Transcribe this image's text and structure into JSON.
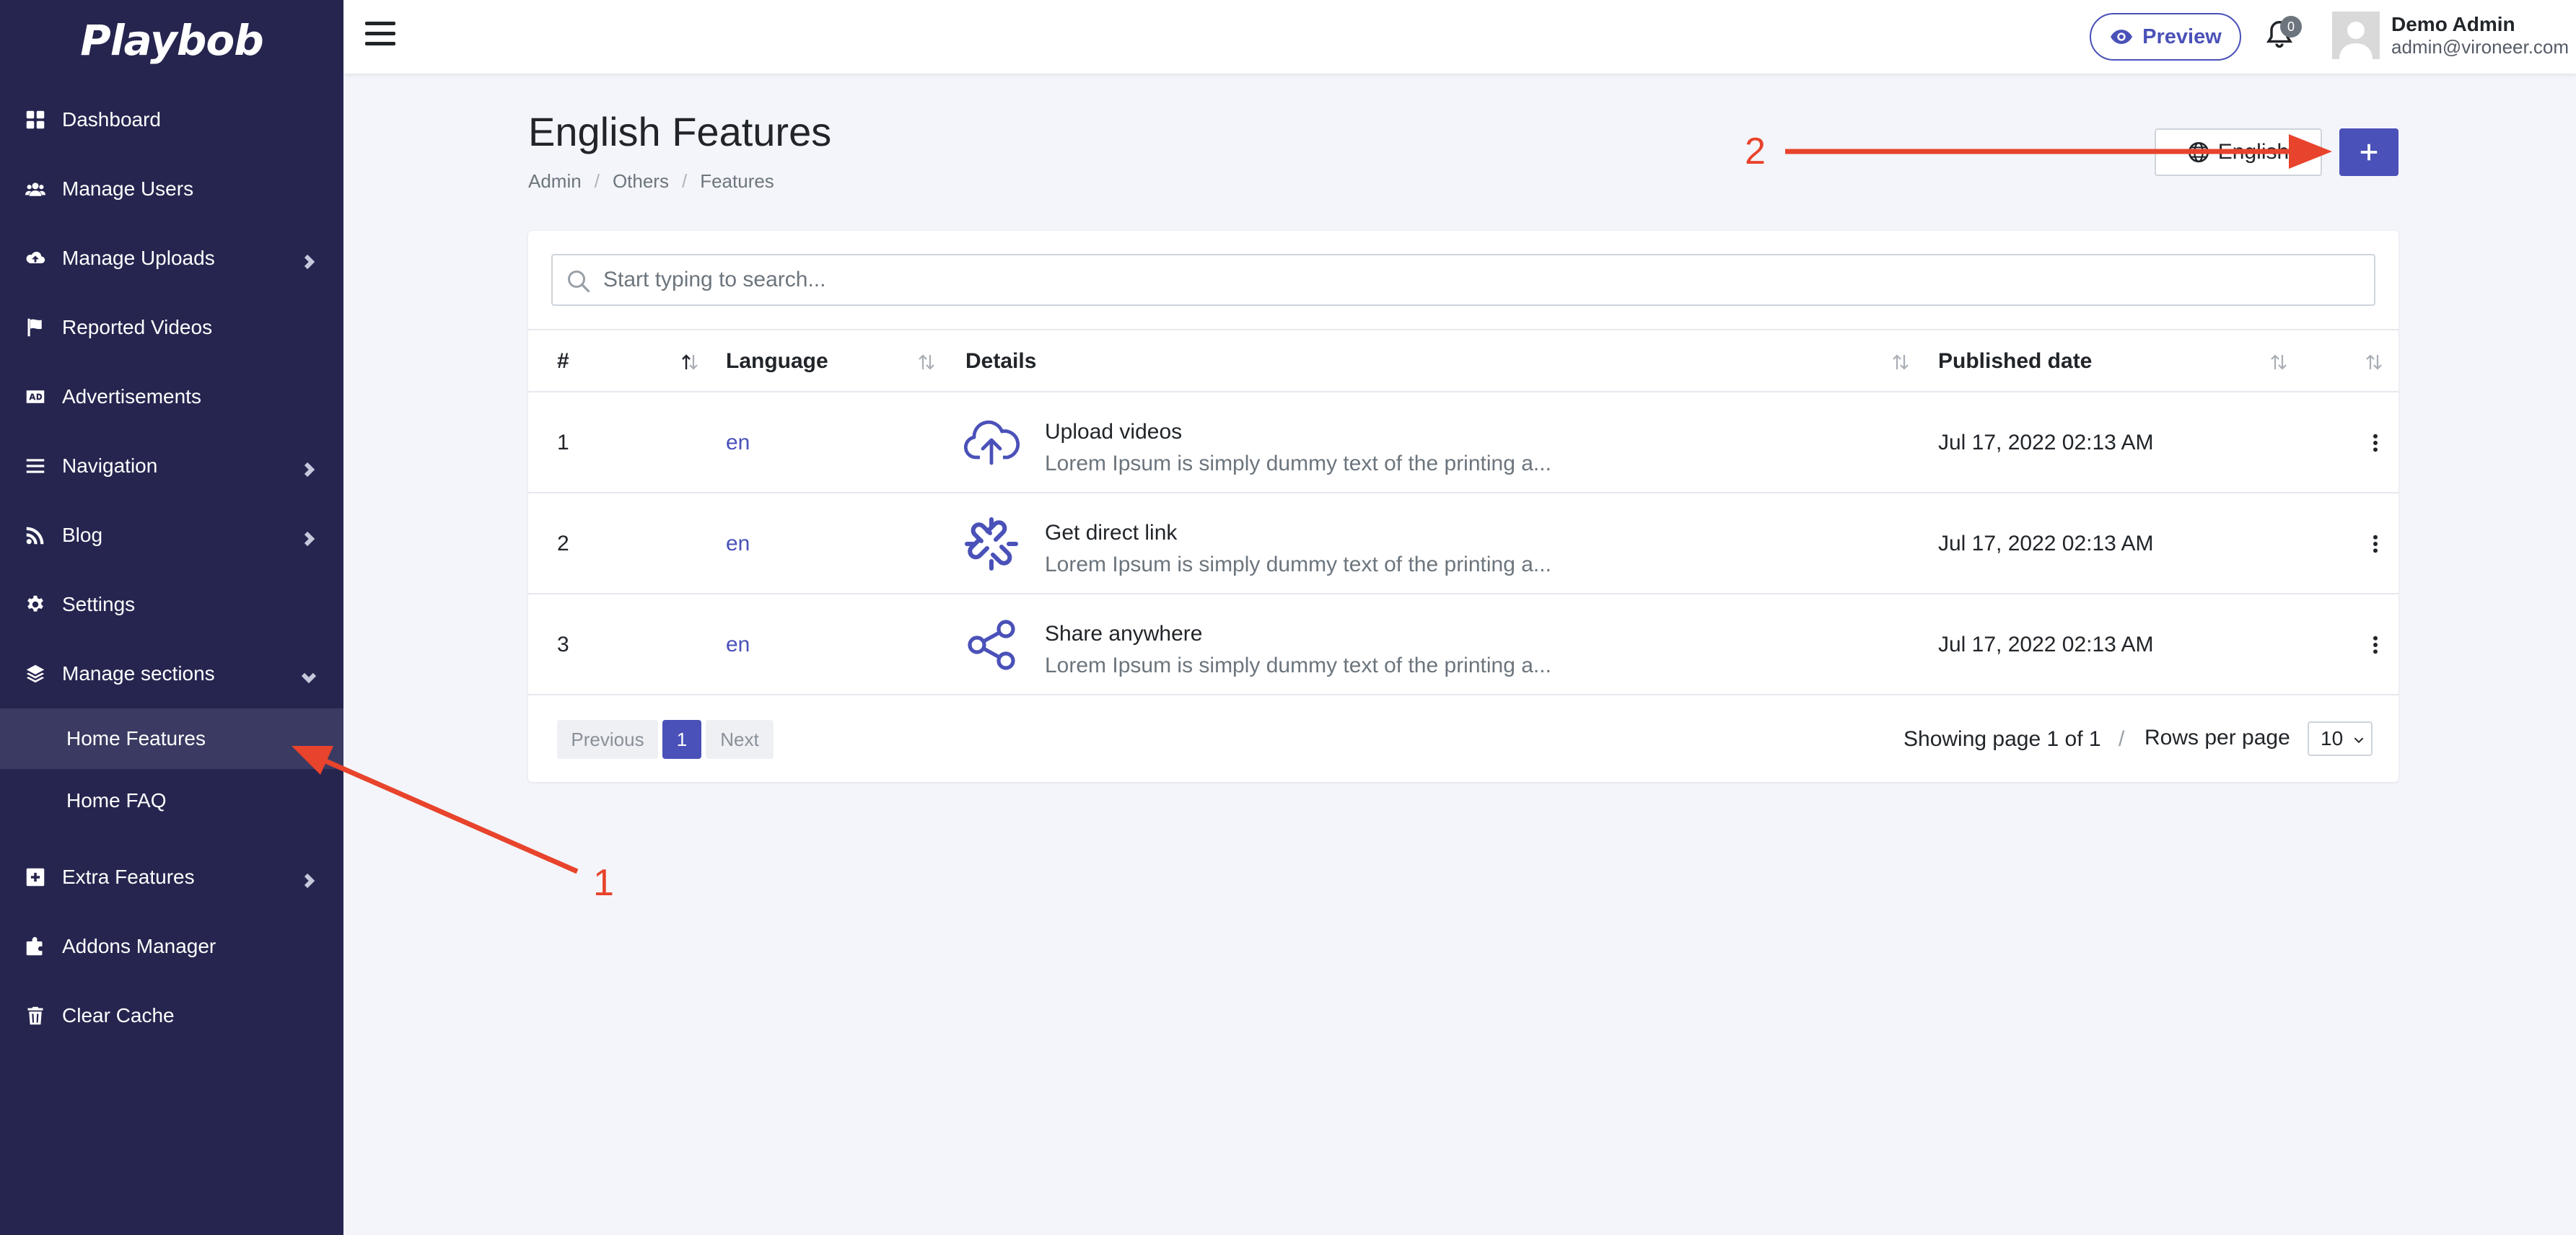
{
  "app": {
    "logo": "Playbob"
  },
  "sidebar": {
    "items": [
      {
        "label": "Dashboard",
        "icon": "dashboard-icon"
      },
      {
        "label": "Manage Users",
        "icon": "users-icon"
      },
      {
        "label": "Manage Uploads",
        "icon": "cloud-upload-icon"
      },
      {
        "label": "Reported Videos",
        "icon": "flag-icon"
      },
      {
        "label": "Advertisements",
        "icon": "ad-icon"
      },
      {
        "label": "Navigation",
        "icon": "bars-icon"
      },
      {
        "label": "Blog",
        "icon": "rss-icon"
      },
      {
        "label": "Settings",
        "icon": "gear-icon"
      },
      {
        "label": "Manage sections",
        "icon": "layers-icon"
      },
      {
        "label": "Extra Features",
        "icon": "plus-square-icon"
      },
      {
        "label": "Addons Manager",
        "icon": "puzzle-icon"
      },
      {
        "label": "Clear Cache",
        "icon": "trash-icon"
      }
    ],
    "subitems": [
      {
        "label": "Home Features",
        "active": true
      },
      {
        "label": "Home FAQ",
        "active": false
      }
    ]
  },
  "topbar": {
    "preview_label": "Preview",
    "notification_count": "0",
    "user_name": "Demo Admin",
    "user_email": "admin@vironeer.com"
  },
  "page": {
    "title": "English Features",
    "breadcrumb": [
      "Admin",
      "Others",
      "Features"
    ],
    "language_button": "English"
  },
  "search": {
    "placeholder": "Start typing to search...",
    "value": ""
  },
  "table": {
    "columns": [
      "#",
      "Language",
      "Details",
      "Published date"
    ],
    "rows": [
      {
        "id": "1",
        "language": "en",
        "title": "Upload videos",
        "description": "Lorem Ipsum is simply dummy text of the printing a...",
        "published": "Jul 17, 2022 02:13 AM",
        "icon": "cloud-upload-icon"
      },
      {
        "id": "2",
        "language": "en",
        "title": "Get direct link",
        "description": "Lorem Ipsum is simply dummy text of the printing a...",
        "published": "Jul 17, 2022 02:13 AM",
        "icon": "link-icon"
      },
      {
        "id": "3",
        "language": "en",
        "title": "Share anywhere",
        "description": "Lorem Ipsum is simply dummy text of the printing a...",
        "published": "Jul 17, 2022 02:13 AM",
        "icon": "share-icon"
      }
    ]
  },
  "pagination": {
    "previous": "Previous",
    "current": "1",
    "next": "Next",
    "info": "Showing page 1 of 1",
    "separator": "/",
    "rows_label": "Rows per page",
    "rows_value": "10"
  },
  "annotations": {
    "label_1": "1",
    "label_2": "2"
  },
  "colors": {
    "sidebar_bg": "#25254f",
    "accent": "#4a51b8",
    "annotation": "#e8432c"
  }
}
